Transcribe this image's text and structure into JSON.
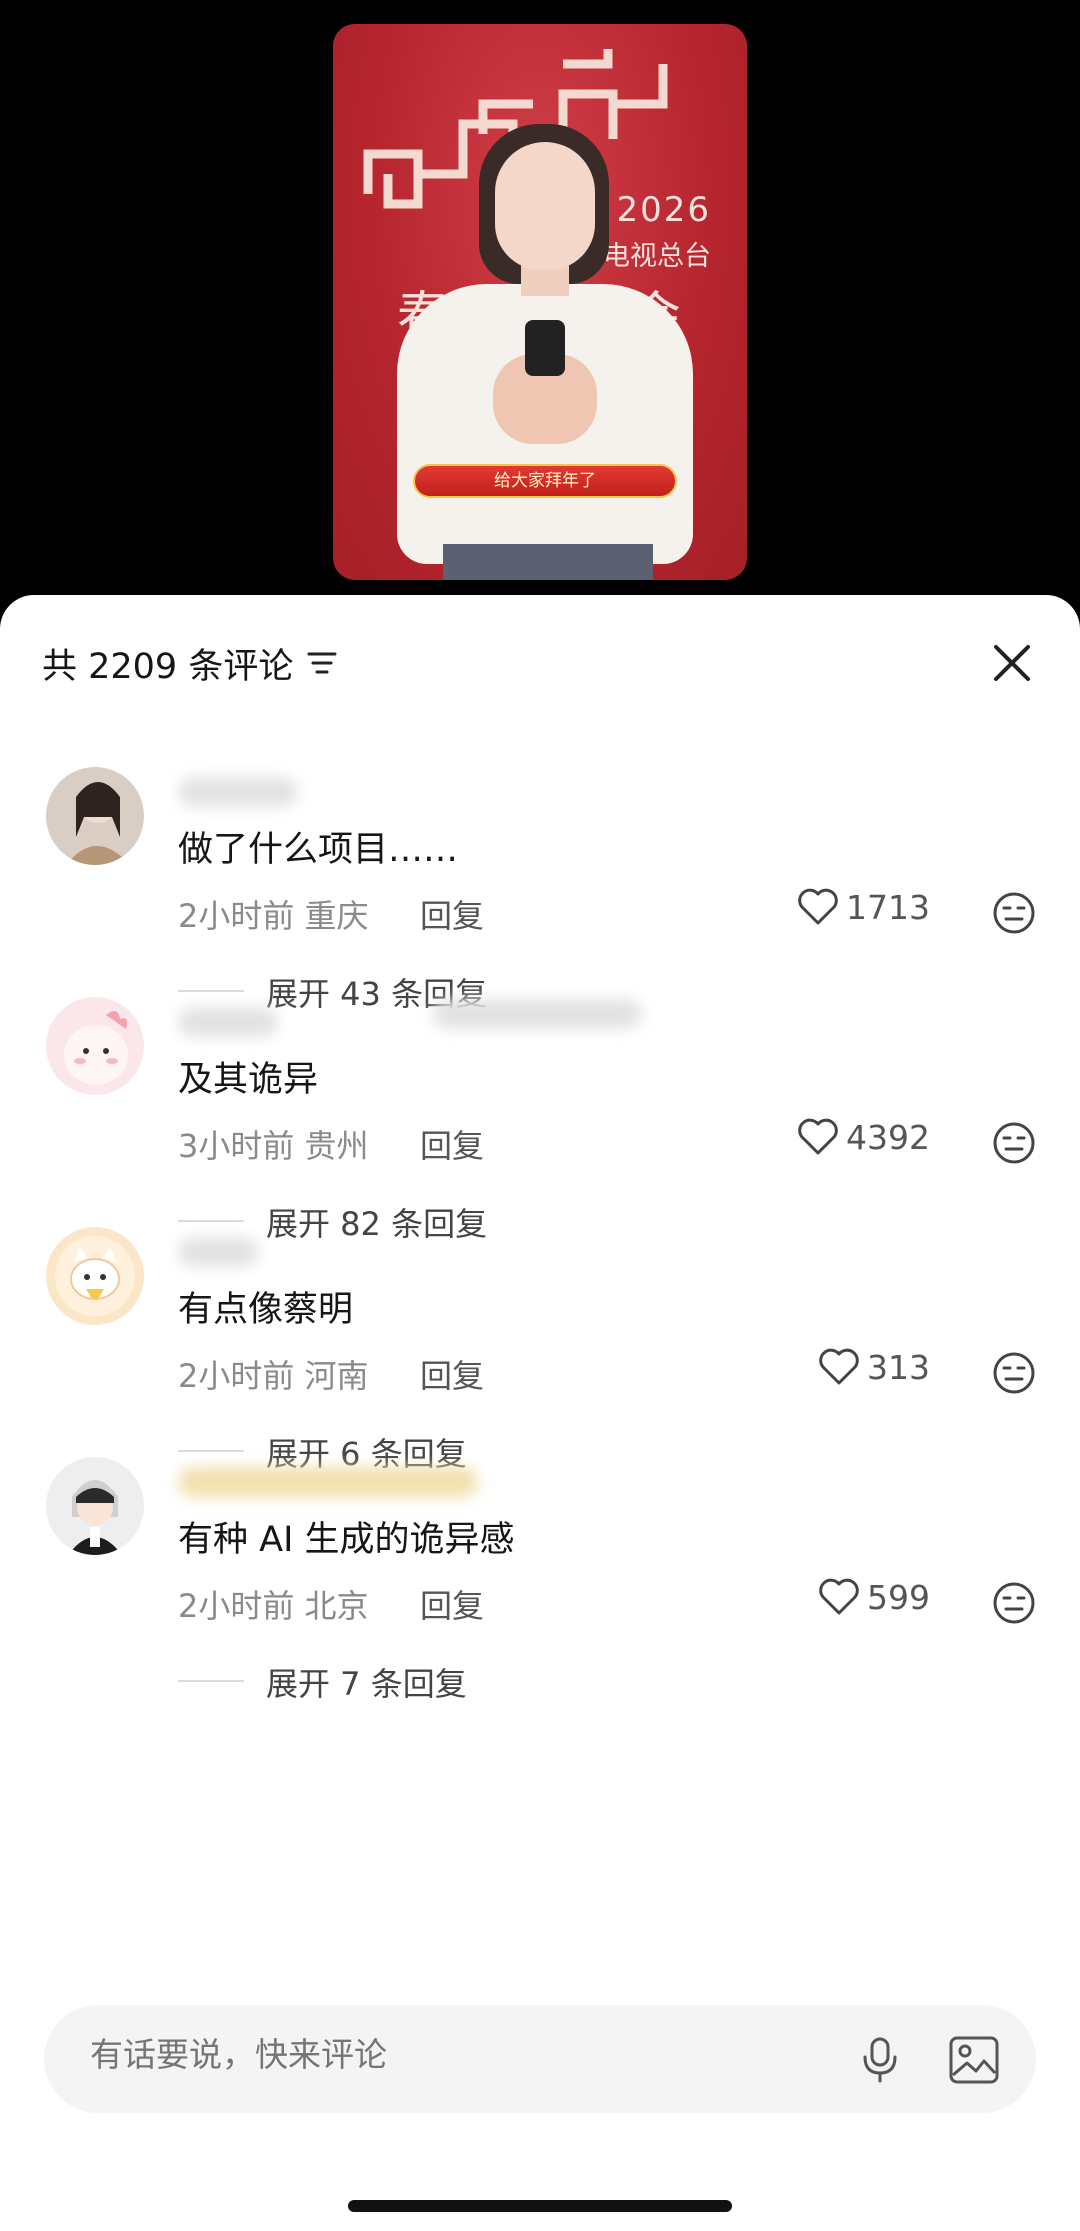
{
  "video": {
    "year": "2026",
    "station": "播电视总台",
    "gala": "春节…晚会",
    "banner": "给大家拜年了"
  },
  "sheet": {
    "comment_count": "共 2209 条评论",
    "filter_icon": "filter-lines-icon",
    "close_icon": "close-x-icon"
  },
  "comments": [
    {
      "text": "做了什么项目……",
      "time": "2小时前",
      "location": "重庆",
      "reply": "回复",
      "likes": "1713",
      "expand": "展开 43 条回复"
    },
    {
      "text": "及其诡异",
      "time": "3小时前",
      "location": "贵州",
      "reply": "回复",
      "likes": "4392",
      "expand": "展开 82 条回复"
    },
    {
      "text": "有点像蔡明",
      "time": "2小时前",
      "location": "河南",
      "reply": "回复",
      "likes": "313",
      "expand": "展开 6 条回复"
    },
    {
      "text": "有种 AI 生成的诡异感",
      "time": "2小时前",
      "location": "北京",
      "reply": "回复",
      "likes": "599",
      "expand": "展开 7 条回复"
    }
  ],
  "input": {
    "placeholder": "有话要说，快来评论"
  },
  "colors": {
    "stage_red": "#b8262f",
    "sheet_bg": "#ffffff",
    "text_primary": "#161616",
    "text_secondary": "#8a8a8a"
  }
}
